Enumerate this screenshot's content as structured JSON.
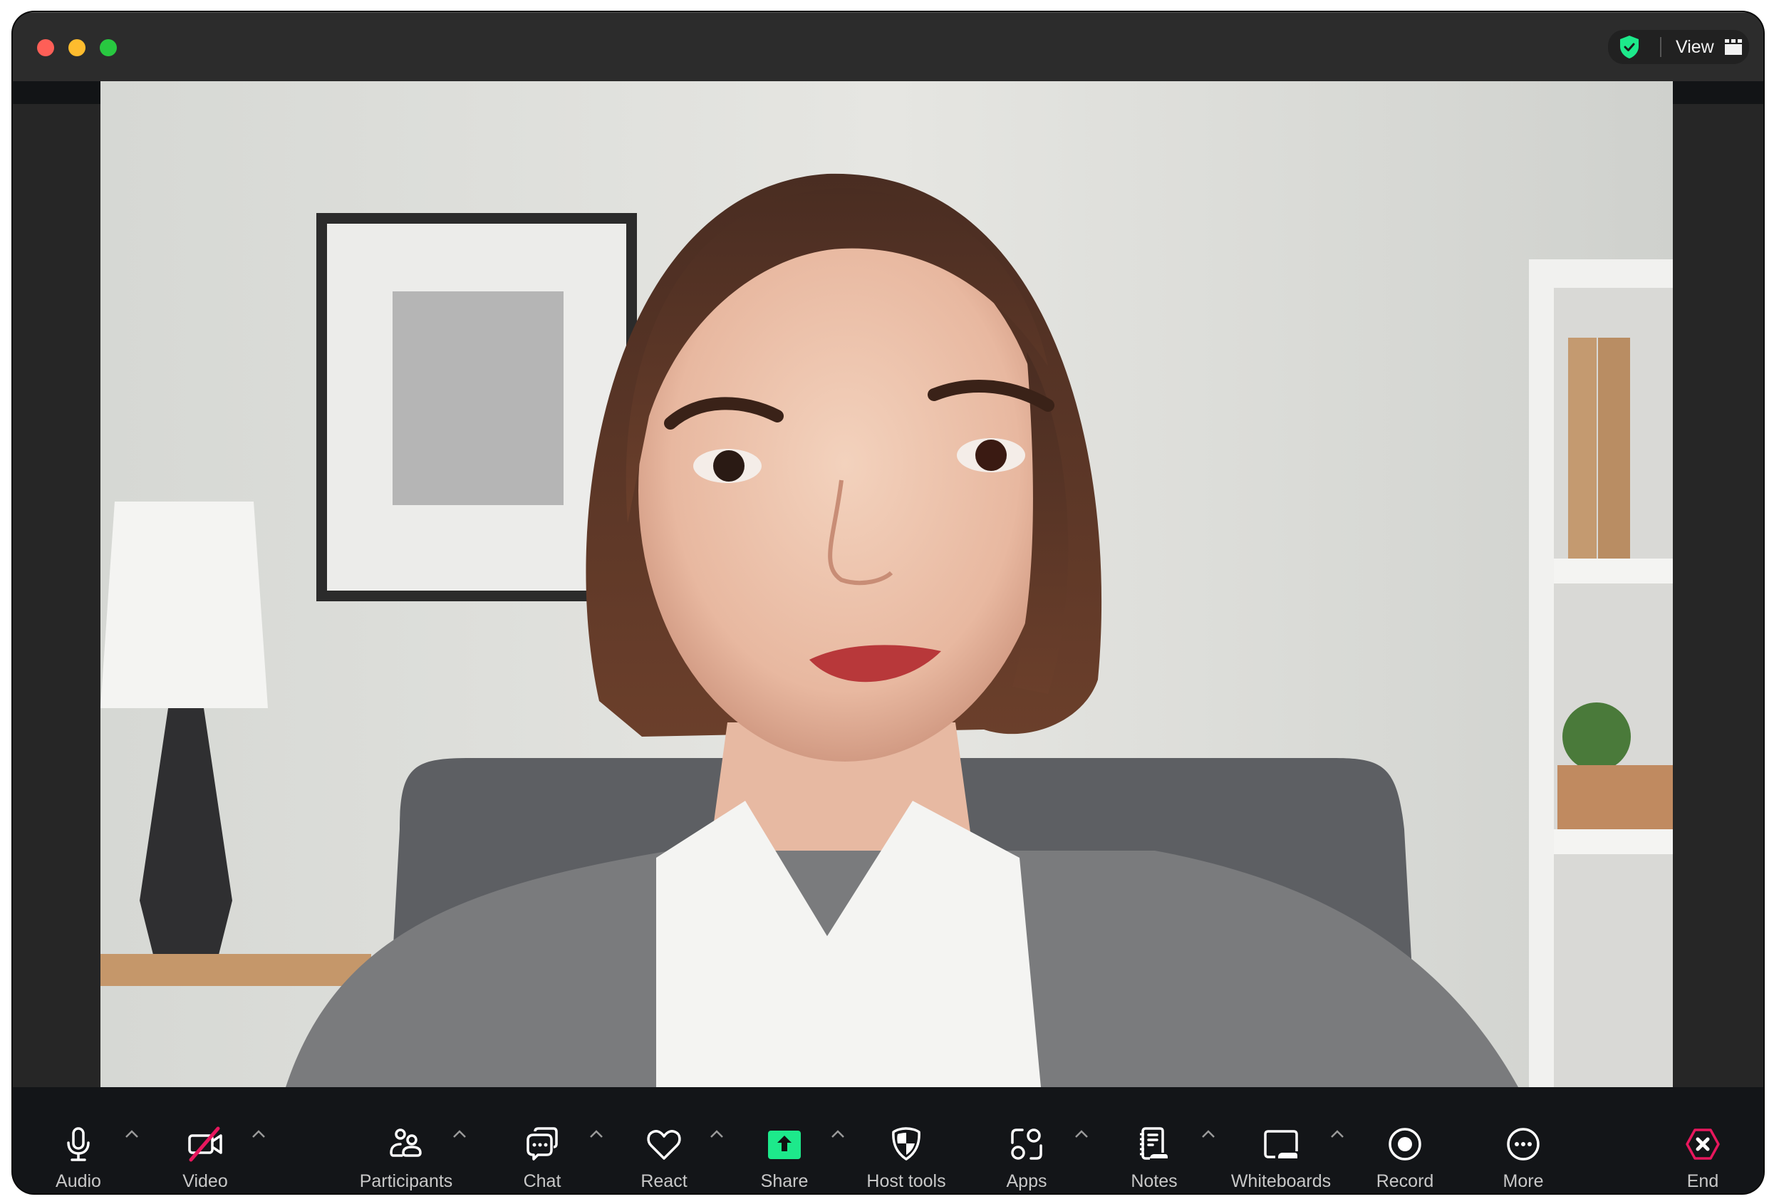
{
  "window": {
    "traffic_lights": [
      {
        "name": "close",
        "color": "#fe5f57"
      },
      {
        "name": "minimize",
        "color": "#febc2e"
      },
      {
        "name": "maximize",
        "color": "#28c840"
      }
    ]
  },
  "header": {
    "security_icon": "shield-check-icon",
    "security_color": "#1de98b",
    "view_label": "View",
    "view_icon": "gallery-grid-icon"
  },
  "video": {
    "description": "Participant video feed: woman with short brown bob hair, white collared shirt and gray cardigan, seated in a gray chair in a bright office with framed picture, lamp and bookshelf"
  },
  "toolbar": {
    "items": [
      {
        "id": "audio",
        "label": "Audio",
        "icon": "microphone-icon",
        "has_menu": true
      },
      {
        "id": "video",
        "label": "Video",
        "icon": "video-off-icon",
        "has_menu": true,
        "state": "off"
      },
      {
        "id": "participants",
        "label": "Participants",
        "icon": "participants-icon",
        "has_menu": true
      },
      {
        "id": "chat",
        "label": "Chat",
        "icon": "chat-icon",
        "has_menu": true
      },
      {
        "id": "react",
        "label": "React",
        "icon": "heart-icon",
        "has_menu": true
      },
      {
        "id": "share",
        "label": "Share",
        "icon": "share-screen-icon",
        "has_menu": true
      },
      {
        "id": "host_tools",
        "label": "Host tools",
        "icon": "host-shield-icon",
        "has_menu": false
      },
      {
        "id": "apps",
        "label": "Apps",
        "icon": "apps-icon",
        "has_menu": true
      },
      {
        "id": "notes",
        "label": "Notes",
        "icon": "notes-icon",
        "has_menu": true
      },
      {
        "id": "whiteboards",
        "label": "Whiteboards",
        "icon": "whiteboard-icon",
        "has_menu": true
      },
      {
        "id": "record",
        "label": "Record",
        "icon": "record-icon",
        "has_menu": false
      },
      {
        "id": "more",
        "label": "More",
        "icon": "more-icon",
        "has_menu": false
      },
      {
        "id": "end",
        "label": "End",
        "icon": "end-meeting-icon",
        "has_menu": false
      }
    ],
    "colors": {
      "share_accent": "#1de98b",
      "video_off_slash": "#e8175d",
      "end_accent": "#e8175d",
      "label": "#c8c8c8"
    }
  }
}
